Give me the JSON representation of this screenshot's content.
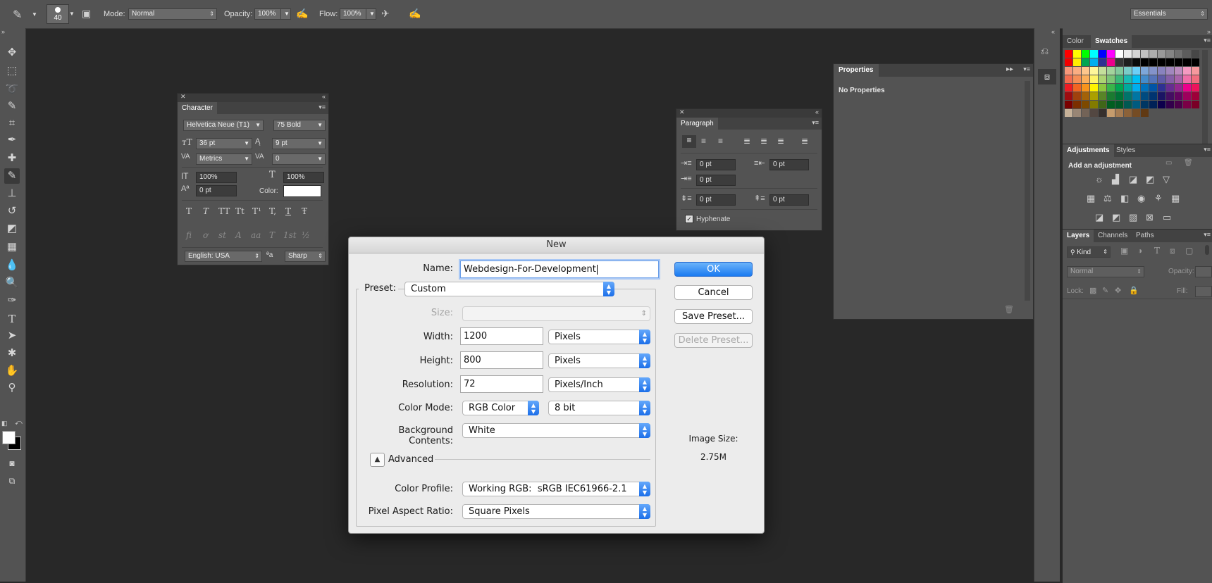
{
  "options_bar": {
    "brush_size": "40",
    "mode_label": "Mode:",
    "mode_value": "Normal",
    "opacity_label": "Opacity:",
    "opacity_value": "100%",
    "flow_label": "Flow:",
    "flow_value": "100%",
    "workspace": "Essentials"
  },
  "character_panel": {
    "title": "Character",
    "font_family": "Helvetica Neue (T1)",
    "font_style": "75 Bold",
    "font_size": "36 pt",
    "leading": "9 pt",
    "kerning": "Metrics",
    "tracking": "0",
    "vertical_scale": "100%",
    "horizontal_scale": "100%",
    "baseline_shift": "0 pt",
    "color_label": "Color:",
    "type_styles": [
      "T",
      "T",
      "TT",
      "Tt",
      "T¹",
      "T,",
      "T",
      "Ŧ"
    ],
    "opentype": [
      "fi",
      "ơ",
      "st",
      "A",
      "aa",
      "T",
      "1st",
      "½"
    ],
    "language": "English: USA",
    "aa_label": "ªa",
    "antialias": "Sharp"
  },
  "paragraph_panel": {
    "title": "Paragraph",
    "indent_left": "0 pt",
    "indent_right": "0 pt",
    "indent_first": "0 pt",
    "space_before": "0 pt",
    "space_after": "0 pt",
    "hyphenate_label": "Hyphenate"
  },
  "properties_panel": {
    "title": "Properties",
    "body": "No Properties"
  },
  "color_panel": {
    "tabs": [
      "Color",
      "Swatches"
    ],
    "swatch_rows": [
      [
        "#ff0000",
        "#ffff00",
        "#00ff00",
        "#00ffff",
        "#0000ff",
        "#ff00ff",
        "#ffffff",
        "#ebebeb",
        "#d6d6d6",
        "#c2c2c2",
        "#adadad",
        "#999999",
        "#858585",
        "#707070",
        "#5c5c5c",
        "#474747"
      ],
      [
        "#f20000",
        "#ffee00",
        "#00a651",
        "#00aeef",
        "#2e3192",
        "#ec008c",
        "#363636",
        "#1f1f1f",
        "#0a0a0a",
        "#000000",
        "#000000",
        "#000000",
        "#000000",
        "#000000",
        "#000000",
        "#000000"
      ],
      [
        "#f7977a",
        "#fbad82",
        "#fdc68c",
        "#fff79a",
        "#c4df9b",
        "#a3d39c",
        "#82ca9c",
        "#7accc8",
        "#6dcff6",
        "#7da7d9",
        "#8393ca",
        "#8882be",
        "#a187be",
        "#bc8cbf",
        "#f49ac1",
        "#f6989d"
      ],
      [
        "#f26c4f",
        "#f68e56",
        "#fbaf5c",
        "#fff467",
        "#acd373",
        "#7cc576",
        "#3bb878",
        "#1abbb4",
        "#00bff3",
        "#438ccb",
        "#5574b9",
        "#605ca8",
        "#855fa8",
        "#a763a9",
        "#ef6ea8",
        "#f16d7e"
      ],
      [
        "#ed1c24",
        "#f26522",
        "#f7941d",
        "#fff200",
        "#8dc63f",
        "#39b54a",
        "#00a651",
        "#00a99d",
        "#00aeef",
        "#0072bc",
        "#0054a6",
        "#2e3192",
        "#662d91",
        "#92278f",
        "#ec008c",
        "#ed145b"
      ],
      [
        "#9e0b0f",
        "#a0410d",
        "#a36209",
        "#aba000",
        "#598527",
        "#1a7b30",
        "#007236",
        "#00746b",
        "#0076a3",
        "#004b80",
        "#003471",
        "#1b1464",
        "#440e62",
        "#630460",
        "#9e005d",
        "#9e0039"
      ],
      [
        "#790000",
        "#7b2e00",
        "#7d4900",
        "#827b00",
        "#406618",
        "#005e20",
        "#005826",
        "#005952",
        "#005b7f",
        "#003663",
        "#002157",
        "#0d004c",
        "#32004b",
        "#4b0049",
        "#7b0046",
        "#7a0026"
      ],
      [
        "#c7b299",
        "#998675",
        "#736357",
        "#534741",
        "#37302d",
        "#c69c6d",
        "#a67c52",
        "#8c6239",
        "#754c24",
        "#603913"
      ]
    ]
  },
  "adjustments_panel": {
    "tabs": [
      "Adjustments",
      "Styles"
    ],
    "heading": "Add an adjustment"
  },
  "layers_panel": {
    "tabs": [
      "Layers",
      "Channels",
      "Paths"
    ],
    "filter_kind": "Kind",
    "blend_mode": "Normal",
    "opacity_label": "Opacity:",
    "lock_label": "Lock:",
    "fill_label": "Fill:"
  },
  "new_dialog": {
    "title": "New",
    "name_label": "Name:",
    "name_value": "Webdesign-For-Development",
    "preset_label": "Preset:",
    "preset_value": "Custom",
    "size_label": "Size:",
    "width_label": "Width:",
    "width_value": "1200",
    "width_unit": "Pixels",
    "height_label": "Height:",
    "height_value": "800",
    "height_unit": "Pixels",
    "resolution_label": "Resolution:",
    "resolution_value": "72",
    "resolution_unit": "Pixels/Inch",
    "color_mode_label": "Color Mode:",
    "color_mode_value": "RGB Color",
    "bit_depth": "8 bit",
    "background_label": "Background Contents:",
    "background_value": "White",
    "advanced_label": "Advanced",
    "color_profile_label": "Color Profile:",
    "color_profile_value": "Working RGB:  sRGB IEC61966-2.1",
    "pixel_aspect_label": "Pixel Aspect Ratio:",
    "pixel_aspect_value": "Square Pixels",
    "ok_label": "OK",
    "cancel_label": "Cancel",
    "save_preset_label": "Save Preset...",
    "delete_preset_label": "Delete Preset...",
    "image_size_label": "Image Size:",
    "image_size_value": "2.75M"
  }
}
